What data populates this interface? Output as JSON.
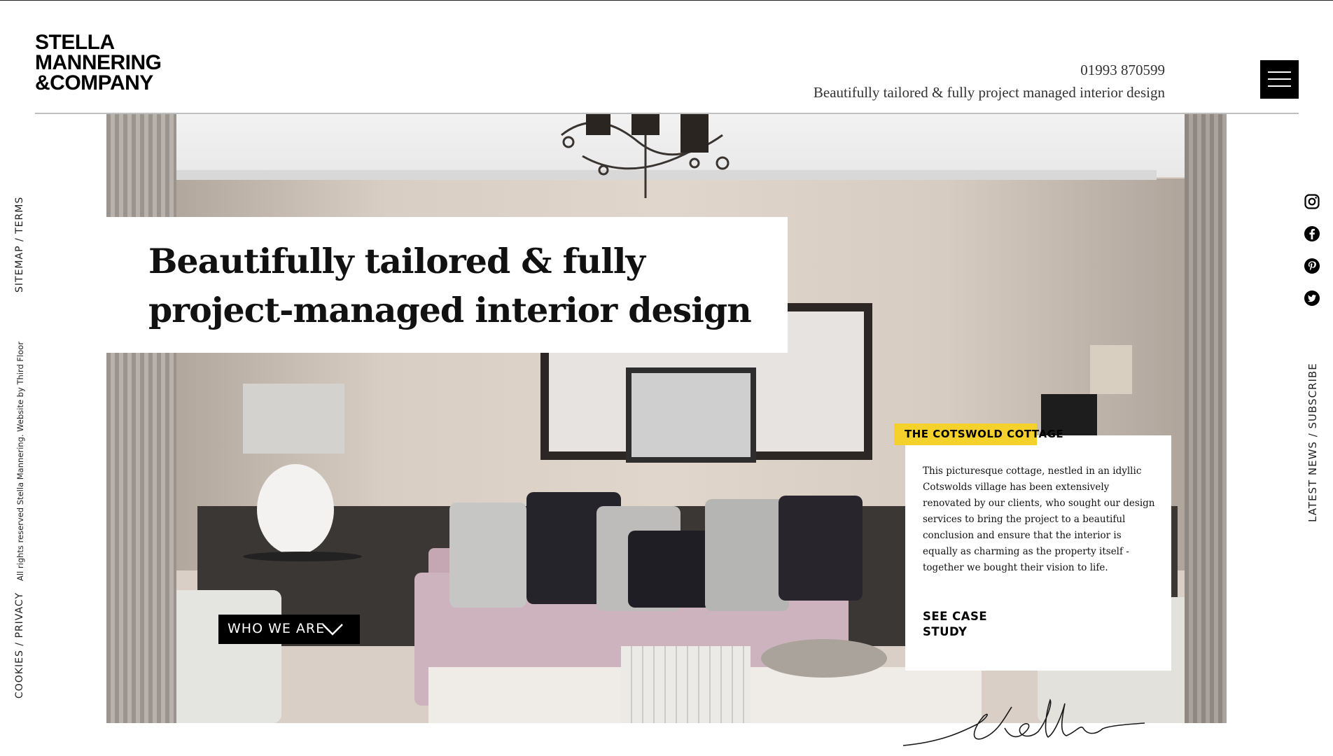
{
  "brand": {
    "logo_lines": [
      "STELLA",
      "MANNERING",
      "&COMPANY"
    ]
  },
  "header": {
    "phone": "01993 870599",
    "tagline": "Beautifully tailored & fully project managed interior design",
    "menu_icon": "hamburger-menu-icon"
  },
  "hero": {
    "title_line1": "Beautifully tailored & fully",
    "title_line2": "project-managed interior design",
    "cta_label": "WHO WE ARE",
    "cta_icon": "chevron-down-icon"
  },
  "case_study": {
    "tag": "THE COTSWOLD COTTAGE",
    "description": "This picturesque cottage, nestled in an idyllic Cotswolds village has been extensively renovated by our clients, who sought our design services to bring the project to a beautiful conclusion and ensure that the interior is equally as charming as the property itself - together we bought their vision to life.",
    "link_line1": "SEE CASE",
    "link_line2": "STUDY",
    "accent_color": "#f5d12b"
  },
  "side_left": {
    "sitemap_terms": "SITEMAP / TERMS",
    "rights": "All rights reserved Stella Mannering. Website by Third Floor",
    "cookies_privacy": "COOKIES / PRIVACY"
  },
  "side_right": {
    "social_icons": [
      "instagram-icon",
      "facebook-icon",
      "pinterest-icon",
      "twitter-icon"
    ],
    "news": "LATEST NEWS / SUBSCRIBE"
  }
}
